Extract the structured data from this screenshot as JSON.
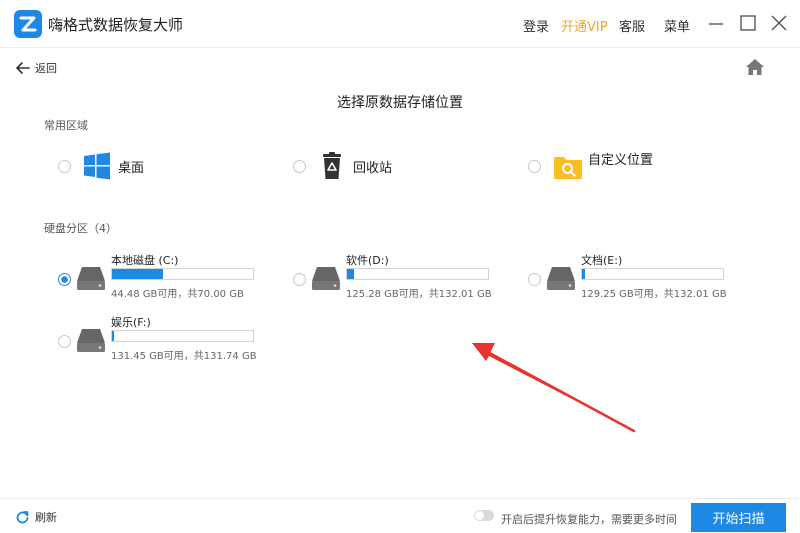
{
  "app": {
    "title": "嗨格式数据恢复大师",
    "brand_color": "#1e88e5",
    "vip_color": "#f5a623",
    "logo_icon": "app-logo-icon"
  },
  "topnav": {
    "login": "登录",
    "vip": "开通VIP",
    "service": "客服",
    "menu": "菜单"
  },
  "window_controls": [
    "minimize-icon",
    "maximize-icon",
    "close-icon"
  ],
  "subheader": {
    "back_label": "返回",
    "back_icon": "arrow-left-icon",
    "home_icon": "home-icon"
  },
  "page_title": "选择原数据存储位置",
  "common": {
    "label": "常用区域",
    "items": [
      {
        "label": "桌面",
        "icon": "windows-icon",
        "selected": false
      },
      {
        "label": "回收站",
        "icon": "recycle-bin-icon",
        "selected": false
      },
      {
        "label": "自定义位置",
        "icon": "folder-search-icon",
        "selected": false
      }
    ]
  },
  "drives": {
    "label": "硬盘分区（4）",
    "items": [
      {
        "name": "本地磁盘 (C:)",
        "info": "44.48 GB可用，共70.00 GB",
        "used_fraction": 0.365,
        "selected": true
      },
      {
        "name": "软件(D:)",
        "info": "125.28 GB可用，共132.01 GB",
        "used_fraction": 0.051,
        "selected": false
      },
      {
        "name": "文档(E:)",
        "info": "129.25 GB可用，共132.01 GB",
        "used_fraction": 0.021,
        "selected": false
      },
      {
        "name": "娱乐(F:)",
        "info": "131.45 GB可用，共131.74 GB",
        "used_fraction": 0.002,
        "selected": false
      }
    ]
  },
  "footer": {
    "refresh_label": "刷新",
    "refresh_icon": "refresh-icon",
    "toggle_label": "开启后提升恢复能力，需要更多时间",
    "toggle_on": false,
    "scan_label": "开始扫描"
  },
  "annotation": {
    "icon": "red-arrow-annotation",
    "color": "#e8322b"
  }
}
